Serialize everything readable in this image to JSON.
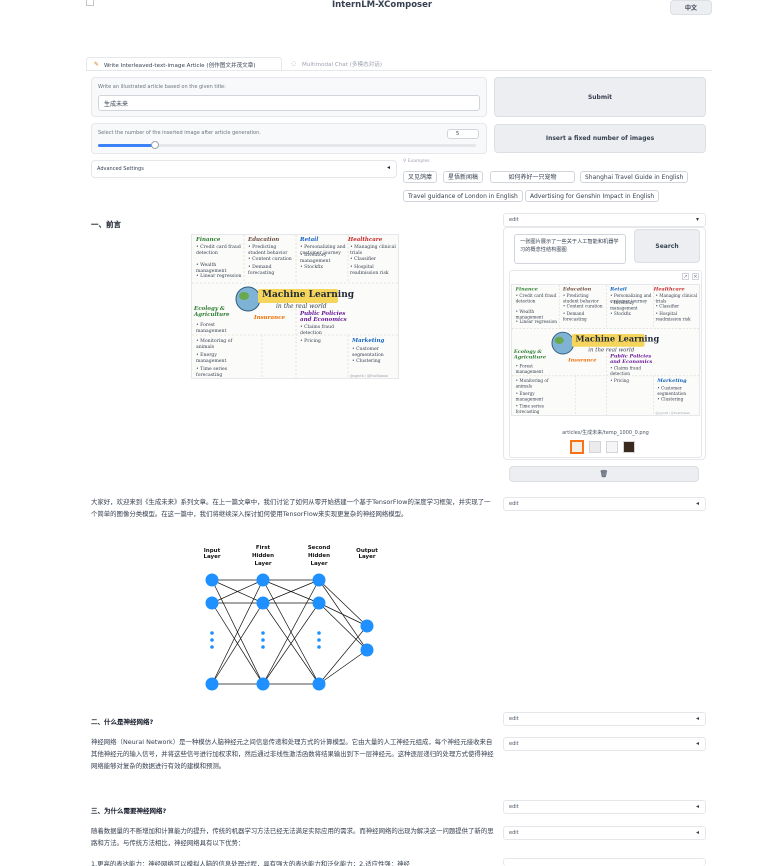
{
  "header": {
    "title": "InternLM-XComposer",
    "lang_button": "中文"
  },
  "tabs": [
    {
      "label": "Write Interleaved-text-image Article (创作图文并茂文章)"
    },
    {
      "label": "Multimodal Chat (多模态对话)"
    }
  ],
  "controls": {
    "title_prompt_label": "Write an illustrated article based on the given title:",
    "title_value": "生成未来",
    "submit_label": "Submit",
    "slider_label": "Select the number of the inserted image after article generation.",
    "slider_value": "5",
    "slider_fraction": 0.15,
    "insert_button": "Insert a fixed number of images",
    "advanced_label": "Advanced Settings",
    "examples_label": "Examples",
    "examples": [
      "叉见鸽瘴",
      "星悟新闻稿",
      "如何养好一只宠物",
      "Shanghai Travel Guide in English",
      "Travel guidance of London in English",
      "Advertising for Genshin Impact in English"
    ]
  },
  "article": {
    "section1_heading": "一、前言",
    "intro_paragraph": "大家好，欢迎来到《生成未来》系列文章。在上一篇文章中，我们讨论了如何从零开始搭建一个基于TensorFlow的深度学习框架，并实现了一个简单的图像分类模型。在这一篇中，我们将继续深入探讨如何使用TensorFlow来实现更复杂的神经网络模型。",
    "section2_heading": "二、什么是神经网络?",
    "section2_paragraph": "神经网络（Neural Network）是一种模仿人脑神经元之间信息传递和处理方式的计算模型。它由大量的人工神经元组成，每个神经元接收来自其他神经元的输入信号，并将这些信号进行加权求和，然后通过非线性激活函数将结果输出到下一层神经元。这种逐层递归的处理方式使得神经网络能够对复杂的数据进行有效的建模和预测。",
    "section3_heading": "三、为什么需要神经网络?",
    "section3_paragraph": "随着数据量的不断增加和计算能力的提升，传统的机器学习方法已经无法满足实际应用的需求。而神经网络的出现为解决这一问题提供了新的思路和方法。与传统方法相比，神经网络具有以下优势：",
    "section3_cut": "1.更高的表达能力：神经网络可以模拟人脑的信息处理过程，具有强大的表达能力和泛化能力；2.适应性强：神经"
  },
  "sketch": {
    "title_line1": "Machine Learning",
    "title_line2": "in the real world",
    "labels": [
      "Finance",
      "Education",
      "Retail",
      "Healthcare",
      "Ecology & Agriculture",
      "Insurance",
      "Public Policies and Economics",
      "Marketing"
    ],
    "items": [
      "Credit card fraud detection",
      "Wealth management",
      "Linear regression",
      "Predicting student behavior",
      "Content curation",
      "Demand forecasting",
      "Inventory management",
      "Stockfix",
      "Personalizing and customer journey",
      "Managing clinical trials",
      "Classifier",
      "Hospital readmission risk",
      "Forest management",
      "Monitoring of animals",
      "Energy management",
      "Time series forecasting",
      "Claims fraud detection",
      "Pricing",
      "Customer segmentation",
      "Clustering"
    ],
    "credit": "@sgrotti / @EvaHuman"
  },
  "network": {
    "layers": [
      "Input Layer",
      "First Hidden Layer",
      "Second Hidden Layer",
      "Output Layer"
    ],
    "dots": "⋮"
  },
  "right_panel": {
    "edit_label": "edit",
    "search_query": "一张图片展示了一些关于人工智能和机器学习的概念性结构图图",
    "search_button": "Search",
    "filename": "articles/生成未来/temp_1000_0.png",
    "delete_icon": "🗑"
  }
}
